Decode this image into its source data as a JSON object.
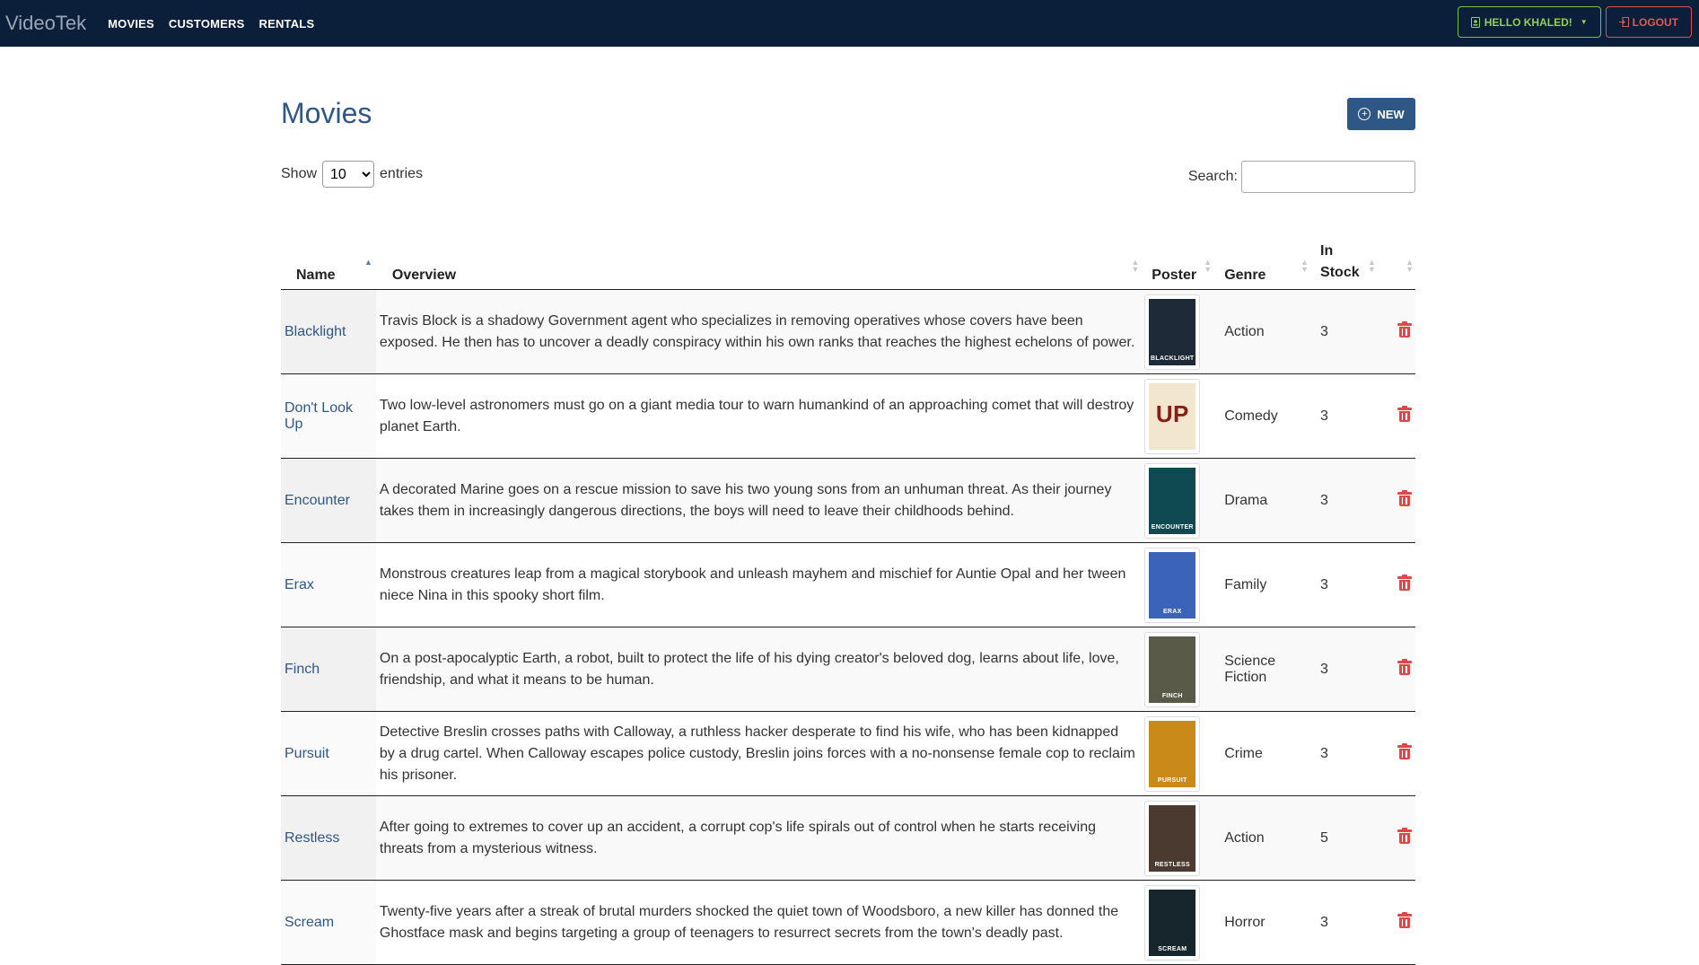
{
  "navbar": {
    "brand": "VideoTek",
    "links": [
      "MOVIES",
      "CUSTOMERS",
      "RENTALS"
    ],
    "hello_label": "HELLO KHALED!",
    "logout_label": "LOGOUT"
  },
  "page": {
    "title": "Movies",
    "new_label": "NEW",
    "show_label": "Show",
    "entries_label": "entries",
    "entries_value": "10",
    "search_label": "Search:"
  },
  "table": {
    "headers": {
      "name": "Name",
      "overview": "Overview",
      "poster": "Poster",
      "genre": "Genre",
      "in_stock_1": "In",
      "in_stock_2": "Stock"
    },
    "rows": [
      {
        "name": "Blacklight",
        "overview": "Travis Block is a shadowy Government agent who specializes in removing operatives whose covers have been exposed. He then has to uncover a deadly conspiracy within his own ranks that reaches the highest echelons of power.",
        "genre": "Action",
        "stock": "3",
        "poster_text": "BLACKLIGHT",
        "poster_color": "#1e2a38"
      },
      {
        "name": "Don't Look Up",
        "overview": "Two low-level astronomers must go on a giant media tour to warn humankind of an approaching comet that will destroy planet Earth.",
        "genre": "Comedy",
        "stock": "3",
        "poster_text": "UP",
        "poster_color": "#f3e6cf"
      },
      {
        "name": "Encounter",
        "overview": "A decorated Marine goes on a rescue mission to save his two young sons from an unhuman threat. As their journey takes them in increasingly dangerous directions, the boys will need to leave their childhoods behind.",
        "genre": "Drama",
        "stock": "3",
        "poster_text": "ENCOUNTER",
        "poster_color": "#0f4a52"
      },
      {
        "name": "Erax",
        "overview": "Monstrous creatures leap from a magical storybook and unleash mayhem and mischief for Auntie Opal and her tween niece Nina in this spooky short film.",
        "genre": "Family",
        "stock": "3",
        "poster_text": "ERAX",
        "poster_color": "#3b64b8"
      },
      {
        "name": "Finch",
        "overview": "On a post-apocalyptic Earth, a robot, built to protect the life of his dying creator's beloved dog, learns about life, love, friendship, and what it means to be human.",
        "genre": "Science Fiction",
        "stock": "3",
        "poster_text": "FINCH",
        "poster_color": "#5a5a48"
      },
      {
        "name": "Pursuit",
        "overview": "Detective Breslin crosses paths with Calloway, a ruthless hacker desperate to find his wife, who has been kidnapped by a drug cartel. When Calloway escapes police custody, Breslin joins forces with a no-nonsense female cop to reclaim his prisoner.",
        "genre": "Crime",
        "stock": "3",
        "poster_text": "PURSUIT",
        "poster_color": "#c98a1a"
      },
      {
        "name": "Restless",
        "overview": "After going to extremes to cover up an accident, a corrupt cop's life spirals out of control when he starts receiving threats from a mysterious witness.",
        "genre": "Action",
        "stock": "5",
        "poster_text": "RESTLESS",
        "poster_color": "#4a3a30"
      },
      {
        "name": "Scream",
        "overview": "Twenty-five years after a streak of brutal murders shocked the quiet town of Woodsboro, a new killer has donned the Ghostface mask and begins targeting a group of teenagers to resurrect secrets from the town's deadly past.",
        "genre": "Horror",
        "stock": "3",
        "poster_text": "SCREAM",
        "poster_color": "#16262c"
      }
    ]
  }
}
